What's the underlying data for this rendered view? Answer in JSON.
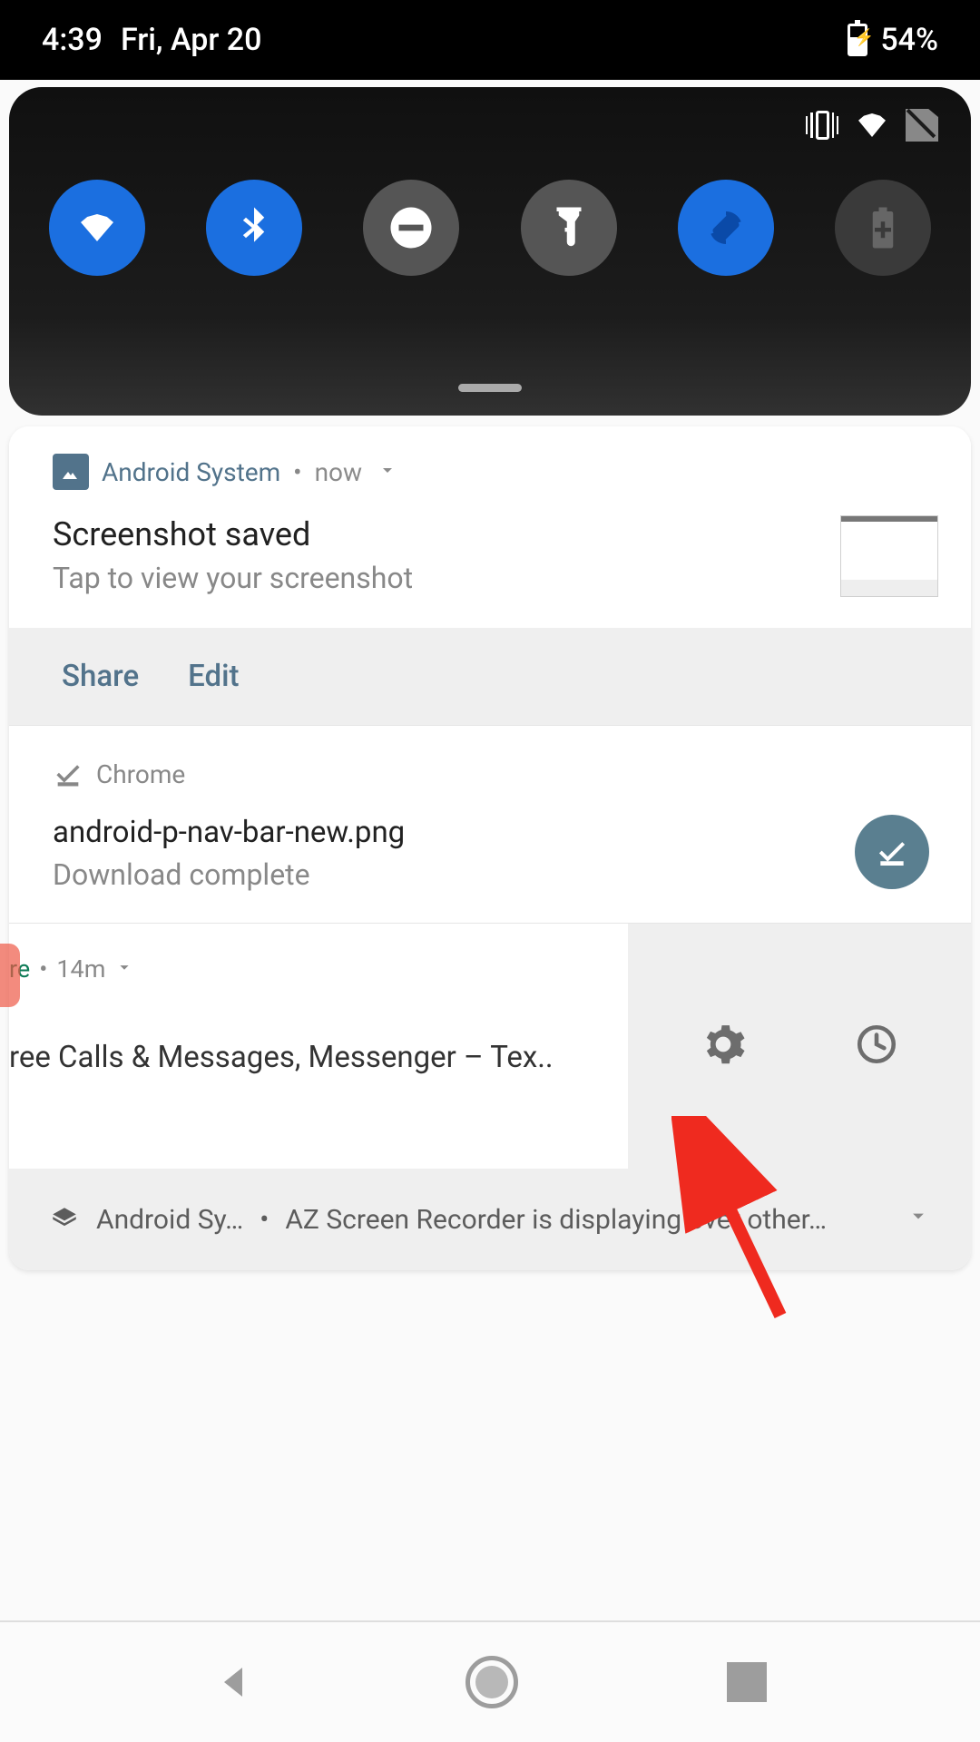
{
  "statusbar": {
    "time": "4:39",
    "date": "Fri, Apr 20",
    "battery_pct": "54%"
  },
  "quick_settings": {
    "tiles": [
      {
        "name": "wifi",
        "state": "on"
      },
      {
        "name": "bluetooth",
        "state": "on"
      },
      {
        "name": "dnd",
        "state": "off"
      },
      {
        "name": "flashlight",
        "state": "off"
      },
      {
        "name": "autorotate",
        "state": "on"
      },
      {
        "name": "battery-saver",
        "state": "dim"
      }
    ]
  },
  "notifications": {
    "screenshot": {
      "app": "Android System",
      "time": "now",
      "title": "Screenshot saved",
      "subtitle": "Tap to view your screenshot",
      "actions": {
        "share": "Share",
        "edit": "Edit"
      }
    },
    "download": {
      "app": "Chrome",
      "title": "android-p-nav-bar-new.png",
      "subtitle": "Download complete"
    },
    "swiped": {
      "header_fragment": "re",
      "time": "14m",
      "body_fragment": "ree Calls & Messages, Messenger – Tex.."
    },
    "summary": {
      "app": "Android Sy…",
      "text": "AZ Screen Recorder is displaying over other…"
    }
  }
}
